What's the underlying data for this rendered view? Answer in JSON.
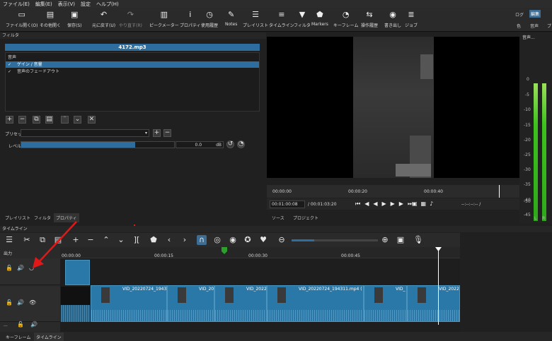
{
  "menu": [
    "ファイル(E)",
    "編集(E)",
    "表示(V)",
    "設定",
    "ヘルプ(H)"
  ],
  "toolbar": {
    "buttons": [
      "ファイル開く(O)",
      "その他開く",
      "保存(S)",
      "元に戻す(U)",
      "やり直す(R)",
      "ピークメーター",
      "プロパティ",
      "使用履歴",
      "Notes",
      "プレイリスト",
      "タイムライン",
      "フィルタ",
      "Markers",
      "キーフレーム",
      "操作履歴",
      "書き出し",
      "ジョブ"
    ],
    "right": [
      "ログ",
      "編集",
      "色",
      "音声",
      "プ"
    ]
  },
  "filters": {
    "title": "フィルタ",
    "file": "4172.mp3",
    "section": "音声",
    "items": [
      {
        "label": "ゲイン / 音量",
        "checked": true,
        "selected": true
      },
      {
        "label": "音声のフェードアウト",
        "checked": true,
        "selected": false
      }
    ],
    "preset_label": "プリセット",
    "level_label": "レベル",
    "level_value": "0.0",
    "level_unit": "dB",
    "level_fraction": 0.74
  },
  "left_tabs": [
    "プレイリスト",
    "フィルタ",
    "プロパティ"
  ],
  "viewer": {
    "ruler": [
      "00:00:00",
      "00:00:20",
      "00:00:40"
    ],
    "position": "00:01:00:08",
    "duration": "/ 00:01:03:20",
    "in_out": "--:--:--:-- /",
    "tabs": [
      "ソース",
      "プロジェクト"
    ]
  },
  "meter": {
    "title": "音声...",
    "ticks": [
      "0",
      "-5",
      "-10",
      "-15",
      "-20",
      "-25",
      "-30",
      "-35",
      "-40",
      "-45",
      "-50"
    ],
    "channels": [
      "L",
      "R"
    ],
    "level_db": -12
  },
  "timeline": {
    "title": "タイムライン",
    "ruler": [
      "00:00:00",
      "00:00:15",
      "00:00:30",
      "00:00:45"
    ],
    "output_label": "出力",
    "track_dots": "...",
    "clips": [
      "VID_20220724_1943",
      "VID_20",
      "VID_2022",
      "VID_20220724_194311.mp4 (",
      "VID_",
      "VID_2022"
    ]
  },
  "bottom_tabs": [
    "キーフレーム",
    "タイムライン"
  ],
  "colors": {
    "accent": "#2d6e9e",
    "playhead": "#ffffff",
    "arrow": "#e01818"
  }
}
